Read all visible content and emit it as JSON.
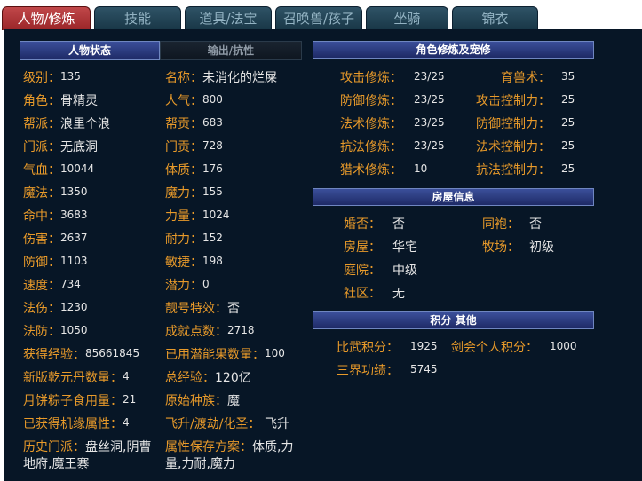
{
  "tabs": [
    {
      "label": "人物/修炼",
      "active": true
    },
    {
      "label": "技能"
    },
    {
      "label": "道具/法宝"
    },
    {
      "label": "召唤兽/孩子"
    },
    {
      "label": "坐骑"
    },
    {
      "label": "锦衣"
    }
  ],
  "status_tabs": {
    "status": "人物状态",
    "output": "输出/抗性"
  },
  "left_col": [
    {
      "key": "级别：",
      "value": "135"
    },
    {
      "key": "角色：",
      "value": "骨精灵"
    },
    {
      "key": "帮派：",
      "value": "浪里个浪"
    },
    {
      "key": "门派：",
      "value": "无底洞"
    },
    {
      "key": "气血：",
      "value": "10044"
    },
    {
      "key": "魔法：",
      "value": "1350"
    },
    {
      "key": "命中：",
      "value": "3683"
    },
    {
      "key": "伤害：",
      "value": "2637"
    },
    {
      "key": "防御：",
      "value": "1103"
    },
    {
      "key": "速度：",
      "value": "734"
    },
    {
      "key": "法伤：",
      "value": "1230"
    },
    {
      "key": "法防：",
      "value": "1050"
    },
    {
      "key": "获得经验：",
      "value": "85661845"
    },
    {
      "key": "新版乾元丹数量：",
      "value": "4"
    },
    {
      "key": "月饼粽子食用量：",
      "value": "21"
    },
    {
      "key": "已获得机缘属性：",
      "value": "4"
    }
  ],
  "right_col": [
    {
      "key": "名称：",
      "value": "未消化的烂屎"
    },
    {
      "key": "人气：",
      "value": "800"
    },
    {
      "key": "帮贡：",
      "value": "683"
    },
    {
      "key": "门贡：",
      "value": "728"
    },
    {
      "key": "体质：",
      "value": "176"
    },
    {
      "key": "魔力：",
      "value": "155"
    },
    {
      "key": "力量：",
      "value": "1024"
    },
    {
      "key": "耐力：",
      "value": "152"
    },
    {
      "key": "敏捷：",
      "value": "198"
    },
    {
      "key": "潜力：",
      "value": "0"
    },
    {
      "key": "靓号特效：",
      "value": "否"
    },
    {
      "key": "成就点数：",
      "value": "2718"
    },
    {
      "key": "已用潜能果数量：",
      "value": "100"
    },
    {
      "key": "总经验：",
      "value": "120亿"
    },
    {
      "key": "原始种族：",
      "value": "魔"
    },
    {
      "key": "飞升/渡劫/化圣：",
      "value": "飞升"
    }
  ],
  "history": {
    "key": "历史门派：",
    "value1": "盘丝洞,阴曹",
    "value2": "地府,魔王寨"
  },
  "save_scheme": {
    "key": "属性保存方案：",
    "value1": "体质,力",
    "value2": "量,力耐,魔力"
  },
  "cultivation": {
    "title": "角色修炼及宠修",
    "left": [
      {
        "key": "攻击修炼：",
        "value": "23/25"
      },
      {
        "key": "防御修炼：",
        "value": "23/25"
      },
      {
        "key": "法术修炼：",
        "value": "23/25"
      },
      {
        "key": "抗法修炼：",
        "value": "23/25"
      },
      {
        "key": "猎术修炼：",
        "value": "10"
      }
    ],
    "right": [
      {
        "key": "育兽术：",
        "value": "35"
      },
      {
        "key": "攻击控制力：",
        "value": "25"
      },
      {
        "key": "防御控制力：",
        "value": "25"
      },
      {
        "key": "法术控制力：",
        "value": "25"
      },
      {
        "key": "抗法控制力：",
        "value": "25"
      }
    ]
  },
  "house": {
    "title": "房屋信息",
    "left": [
      {
        "key": "婚否：",
        "value": "否"
      },
      {
        "key": "房屋：",
        "value": "华宅"
      },
      {
        "key": "庭院：",
        "value": "中级"
      },
      {
        "key": "社区：",
        "value": "无"
      }
    ],
    "right": [
      {
        "key": "同袍：",
        "value": "否"
      },
      {
        "key": "牧场：",
        "value": "初级"
      }
    ]
  },
  "points": {
    "title": "积分 其他",
    "pvp_key": "比武积分：",
    "pvp_value": "1925",
    "sword_key": "剑会个人积分：",
    "sword_value": "1000",
    "merit_key": "三界功绩：",
    "merit_value": "5745"
  },
  "colors": {
    "label": "#e89a2a",
    "value": "#e6e6e6",
    "panel_bg": "#071626",
    "active_tab": "#b3383b"
  }
}
